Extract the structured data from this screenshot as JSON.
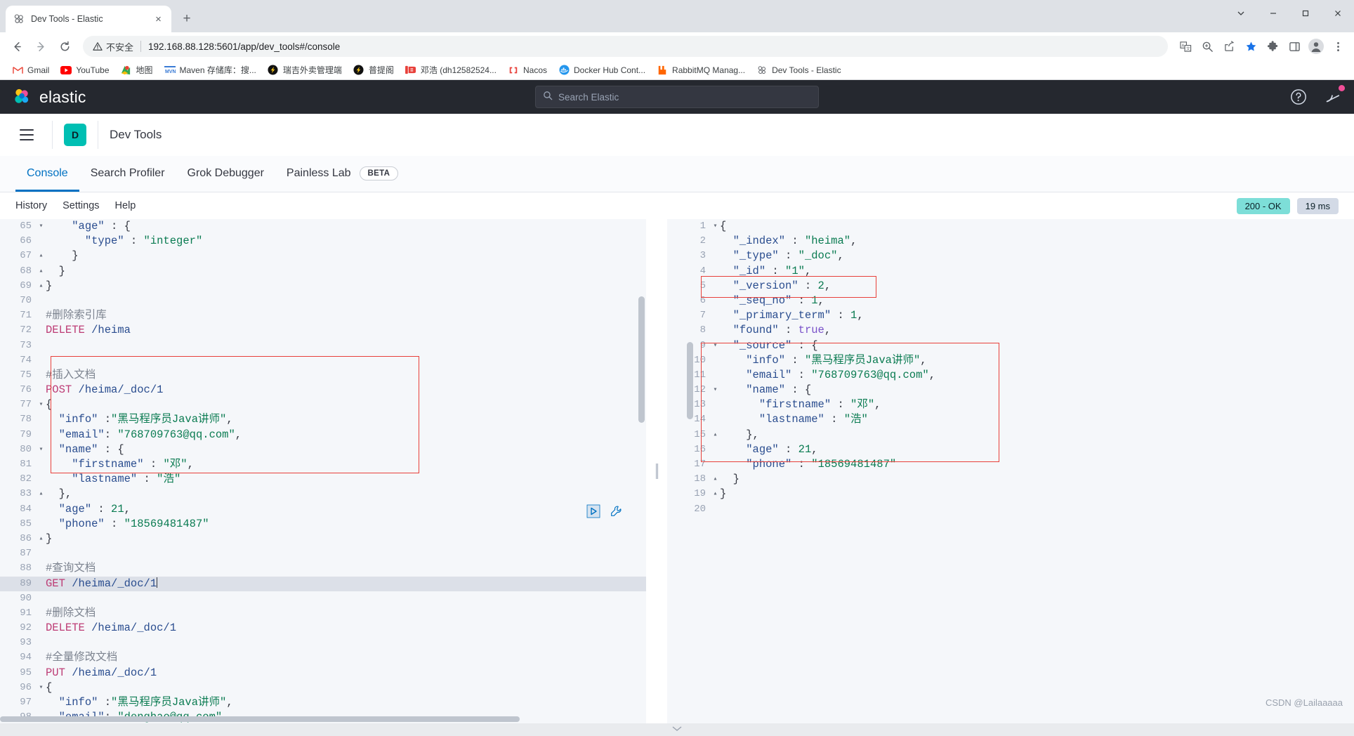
{
  "browser": {
    "tab": {
      "title": "Dev Tools - Elastic",
      "favicon": "elastic-favicon",
      "close_label": "×"
    },
    "new_tab_label": "+",
    "window_controls": {
      "chevron": "⌄",
      "minimize": "—",
      "maximize": "□",
      "close": "✕"
    },
    "nav": {
      "back": "←",
      "forward": "→",
      "reload": "⟳"
    },
    "omnibox": {
      "warning_text": "不安全",
      "url": "192.168.88.128:5601/app/dev_tools#/console",
      "url_host": "192.168.88.128:5601",
      "url_path": "/app/dev_tools#/console"
    },
    "toolbar_icons": [
      "translate-icon",
      "zoom-icon",
      "share-icon",
      "bookmark-star-icon",
      "extensions-puzzle-icon",
      "sidepanel-icon",
      "profile-avatar-icon",
      "chrome-menu-icon"
    ],
    "bookmarks": [
      {
        "label": "Gmail",
        "icon": "gmail-icon"
      },
      {
        "label": "YouTube",
        "icon": "youtube-icon"
      },
      {
        "label": "地图",
        "icon": "maps-icon"
      },
      {
        "label": "Maven 存储库：搜...",
        "icon": "maven-icon"
      },
      {
        "label": "瑞吉外卖管理端",
        "icon": "ruiji-icon"
      },
      {
        "label": "普提阁",
        "icon": "puti-icon"
      },
      {
        "label": "邓浩 (dh12582524...",
        "icon": "csdn-icon"
      },
      {
        "label": "Nacos",
        "icon": "nacos-icon"
      },
      {
        "label": "Docker Hub Cont...",
        "icon": "docker-icon"
      },
      {
        "label": "RabbitMQ Manag...",
        "icon": "rabbitmq-icon"
      },
      {
        "label": "Dev Tools - Elastic",
        "icon": "elastic-favicon"
      }
    ]
  },
  "elastic": {
    "brand": "elastic",
    "search_placeholder": "Search Elastic",
    "header_icons": [
      "help-icon",
      "notifications-icon"
    ],
    "breadcrumb": {
      "app_initial": "D",
      "title": "Dev Tools"
    },
    "tabs": [
      {
        "label": "Console",
        "active": true,
        "badge": ""
      },
      {
        "label": "Search Profiler",
        "active": false,
        "badge": ""
      },
      {
        "label": "Grok Debugger",
        "active": false,
        "badge": ""
      },
      {
        "label": "Painless Lab",
        "active": false,
        "badge": "BETA"
      }
    ],
    "toolbar": [
      "History",
      "Settings",
      "Help"
    ],
    "status": {
      "code": "200 - OK",
      "time": "19 ms"
    },
    "accent_colors": {
      "primary": "#0071c2",
      "app_icon_bg": "#00BFB3",
      "status_ok_bg": "#7dded8",
      "status_ms_bg": "#d3dae6",
      "annotation": "#e8403a",
      "header_bg": "#25282f"
    }
  },
  "request_editor": {
    "first_line": 64,
    "active_line": 89,
    "lines": [
      {
        "n": 65,
        "fold": "▾",
        "tokens": [
          {
            "t": "plain",
            "v": "    "
          },
          {
            "t": "key",
            "v": "\"age\""
          },
          {
            "t": "punc",
            "v": " : {"
          }
        ]
      },
      {
        "n": 66,
        "fold": "",
        "tokens": [
          {
            "t": "plain",
            "v": "      "
          },
          {
            "t": "key",
            "v": "\"type\""
          },
          {
            "t": "punc",
            "v": " : "
          },
          {
            "t": "str",
            "v": "\"integer\""
          }
        ]
      },
      {
        "n": 67,
        "fold": "▴",
        "tokens": [
          {
            "t": "punc",
            "v": "    }"
          }
        ]
      },
      {
        "n": 68,
        "fold": "▴",
        "tokens": [
          {
            "t": "punc",
            "v": "  }"
          }
        ]
      },
      {
        "n": 69,
        "fold": "▴",
        "tokens": [
          {
            "t": "punc",
            "v": "}"
          }
        ]
      },
      {
        "n": 70,
        "fold": "",
        "tokens": []
      },
      {
        "n": 71,
        "fold": "",
        "tokens": [
          {
            "t": "comment",
            "v": "#删除索引库"
          }
        ]
      },
      {
        "n": 72,
        "fold": "",
        "tokens": [
          {
            "t": "method",
            "v": "DELETE"
          },
          {
            "t": "url",
            "v": " /heima"
          }
        ]
      },
      {
        "n": 73,
        "fold": "",
        "tokens": []
      },
      {
        "n": 74,
        "fold": "",
        "tokens": []
      },
      {
        "n": 75,
        "fold": "",
        "tokens": [
          {
            "t": "comment",
            "v": "#插入文档"
          }
        ]
      },
      {
        "n": 76,
        "fold": "",
        "tokens": [
          {
            "t": "method",
            "v": "POST"
          },
          {
            "t": "url",
            "v": " /heima/_doc/1"
          }
        ]
      },
      {
        "n": 77,
        "fold": "▾",
        "tokens": [
          {
            "t": "punc",
            "v": "{"
          }
        ]
      },
      {
        "n": 78,
        "fold": "",
        "tokens": [
          {
            "t": "plain",
            "v": "  "
          },
          {
            "t": "key",
            "v": "\"info\""
          },
          {
            "t": "punc",
            "v": " :"
          },
          {
            "t": "str",
            "v": "\"黑马程序员Java讲师\""
          },
          {
            "t": "punc",
            "v": ","
          }
        ]
      },
      {
        "n": 79,
        "fold": "",
        "tokens": [
          {
            "t": "plain",
            "v": "  "
          },
          {
            "t": "key",
            "v": "\"email\""
          },
          {
            "t": "punc",
            "v": ": "
          },
          {
            "t": "str",
            "v": "\"768709763@qq.com\""
          },
          {
            "t": "punc",
            "v": ","
          }
        ]
      },
      {
        "n": 80,
        "fold": "▾",
        "tokens": [
          {
            "t": "plain",
            "v": "  "
          },
          {
            "t": "key",
            "v": "\"name\""
          },
          {
            "t": "punc",
            "v": " : {"
          }
        ]
      },
      {
        "n": 81,
        "fold": "",
        "tokens": [
          {
            "t": "plain",
            "v": "    "
          },
          {
            "t": "key",
            "v": "\"firstname\""
          },
          {
            "t": "punc",
            "v": " : "
          },
          {
            "t": "str",
            "v": "\"邓\""
          },
          {
            "t": "punc",
            "v": ","
          }
        ]
      },
      {
        "n": 82,
        "fold": "",
        "tokens": [
          {
            "t": "plain",
            "v": "    "
          },
          {
            "t": "key",
            "v": "\"lastname\""
          },
          {
            "t": "punc",
            "v": " : "
          },
          {
            "t": "str",
            "v": "\"浩\""
          }
        ]
      },
      {
        "n": 83,
        "fold": "▴",
        "tokens": [
          {
            "t": "punc",
            "v": "  },"
          }
        ]
      },
      {
        "n": 84,
        "fold": "",
        "tokens": [
          {
            "t": "plain",
            "v": "  "
          },
          {
            "t": "key",
            "v": "\"age\""
          },
          {
            "t": "punc",
            "v": " : "
          },
          {
            "t": "num",
            "v": "21"
          },
          {
            "t": "punc",
            "v": ","
          }
        ]
      },
      {
        "n": 85,
        "fold": "",
        "tokens": [
          {
            "t": "plain",
            "v": "  "
          },
          {
            "t": "key",
            "v": "\"phone\""
          },
          {
            "t": "punc",
            "v": " : "
          },
          {
            "t": "str",
            "v": "\"18569481487\""
          }
        ]
      },
      {
        "n": 86,
        "fold": "▴",
        "tokens": [
          {
            "t": "punc",
            "v": "}"
          }
        ]
      },
      {
        "n": 87,
        "fold": "",
        "tokens": []
      },
      {
        "n": 88,
        "fold": "",
        "tokens": [
          {
            "t": "comment",
            "v": "#查询文档"
          }
        ]
      },
      {
        "n": 89,
        "fold": "",
        "tokens": [
          {
            "t": "method",
            "v": "GET"
          },
          {
            "t": "url",
            "v": " /heima/_doc/1"
          },
          {
            "t": "caret",
            "v": ""
          }
        ]
      },
      {
        "n": 90,
        "fold": "",
        "tokens": []
      },
      {
        "n": 91,
        "fold": "",
        "tokens": [
          {
            "t": "comment",
            "v": "#删除文档"
          }
        ]
      },
      {
        "n": 92,
        "fold": "",
        "tokens": [
          {
            "t": "method",
            "v": "DELETE"
          },
          {
            "t": "url",
            "v": " /heima/_doc/1"
          }
        ]
      },
      {
        "n": 93,
        "fold": "",
        "tokens": []
      },
      {
        "n": 94,
        "fold": "",
        "tokens": [
          {
            "t": "comment",
            "v": "#全量修改文档"
          }
        ]
      },
      {
        "n": 95,
        "fold": "",
        "tokens": [
          {
            "t": "method",
            "v": "PUT"
          },
          {
            "t": "url",
            "v": " /heima/_doc/1"
          }
        ]
      },
      {
        "n": 96,
        "fold": "▾",
        "tokens": [
          {
            "t": "punc",
            "v": "{"
          }
        ]
      },
      {
        "n": 97,
        "fold": "",
        "tokens": [
          {
            "t": "plain",
            "v": "  "
          },
          {
            "t": "key",
            "v": "\"info\""
          },
          {
            "t": "punc",
            "v": " :"
          },
          {
            "t": "str",
            "v": "\"黑马程序员Java讲师\""
          },
          {
            "t": "punc",
            "v": ","
          }
        ]
      },
      {
        "n": 98,
        "fold": "",
        "tokens": [
          {
            "t": "plain",
            "v": "  "
          },
          {
            "t": "key",
            "v": "\"email\""
          },
          {
            "t": "punc",
            "v": ": "
          },
          {
            "t": "str",
            "v": "\"denghao@qq.com\""
          },
          {
            "t": "punc",
            "v": ","
          }
        ]
      }
    ],
    "actions": {
      "play": "play-icon",
      "wrench": "wrench-icon"
    }
  },
  "response_editor": {
    "lines": [
      {
        "n": 1,
        "fold": "▾",
        "tokens": [
          {
            "t": "punc",
            "v": "{"
          }
        ]
      },
      {
        "n": 2,
        "fold": "",
        "tokens": [
          {
            "t": "plain",
            "v": "  "
          },
          {
            "t": "key",
            "v": "\"_index\""
          },
          {
            "t": "punc",
            "v": " : "
          },
          {
            "t": "str",
            "v": "\"heima\""
          },
          {
            "t": "punc",
            "v": ","
          }
        ]
      },
      {
        "n": 3,
        "fold": "",
        "tokens": [
          {
            "t": "plain",
            "v": "  "
          },
          {
            "t": "key",
            "v": "\"_type\""
          },
          {
            "t": "punc",
            "v": " : "
          },
          {
            "t": "str",
            "v": "\"_doc\""
          },
          {
            "t": "punc",
            "v": ","
          }
        ]
      },
      {
        "n": 4,
        "fold": "",
        "tokens": [
          {
            "t": "plain",
            "v": "  "
          },
          {
            "t": "key",
            "v": "\"_id\""
          },
          {
            "t": "punc",
            "v": " : "
          },
          {
            "t": "str",
            "v": "\"1\""
          },
          {
            "t": "punc",
            "v": ","
          }
        ]
      },
      {
        "n": 5,
        "fold": "",
        "tokens": [
          {
            "t": "plain",
            "v": "  "
          },
          {
            "t": "key",
            "v": "\"_version\""
          },
          {
            "t": "punc",
            "v": " : "
          },
          {
            "t": "num",
            "v": "2"
          },
          {
            "t": "punc",
            "v": ","
          }
        ]
      },
      {
        "n": 6,
        "fold": "",
        "tokens": [
          {
            "t": "plain",
            "v": "  "
          },
          {
            "t": "key",
            "v": "\"_seq_no\""
          },
          {
            "t": "punc",
            "v": " : "
          },
          {
            "t": "num",
            "v": "1"
          },
          {
            "t": "punc",
            "v": ","
          }
        ]
      },
      {
        "n": 7,
        "fold": "",
        "tokens": [
          {
            "t": "plain",
            "v": "  "
          },
          {
            "t": "key",
            "v": "\"_primary_term\""
          },
          {
            "t": "punc",
            "v": " : "
          },
          {
            "t": "num",
            "v": "1"
          },
          {
            "t": "punc",
            "v": ","
          }
        ]
      },
      {
        "n": 8,
        "fold": "",
        "tokens": [
          {
            "t": "plain",
            "v": "  "
          },
          {
            "t": "key",
            "v": "\"found\""
          },
          {
            "t": "punc",
            "v": " : "
          },
          {
            "t": "bool",
            "v": "true"
          },
          {
            "t": "punc",
            "v": ","
          }
        ]
      },
      {
        "n": 9,
        "fold": "▾",
        "tokens": [
          {
            "t": "plain",
            "v": "  "
          },
          {
            "t": "key",
            "v": "\"_source\""
          },
          {
            "t": "punc",
            "v": " : {"
          }
        ]
      },
      {
        "n": 10,
        "fold": "",
        "tokens": [
          {
            "t": "plain",
            "v": "    "
          },
          {
            "t": "key",
            "v": "\"info\""
          },
          {
            "t": "punc",
            "v": " : "
          },
          {
            "t": "str",
            "v": "\"黑马程序员Java讲师\""
          },
          {
            "t": "punc",
            "v": ","
          }
        ]
      },
      {
        "n": 11,
        "fold": "",
        "tokens": [
          {
            "t": "plain",
            "v": "    "
          },
          {
            "t": "key",
            "v": "\"email\""
          },
          {
            "t": "punc",
            "v": " : "
          },
          {
            "t": "str",
            "v": "\"768709763@qq.com\""
          },
          {
            "t": "punc",
            "v": ","
          }
        ]
      },
      {
        "n": 12,
        "fold": "▾",
        "tokens": [
          {
            "t": "plain",
            "v": "    "
          },
          {
            "t": "key",
            "v": "\"name\""
          },
          {
            "t": "punc",
            "v": " : {"
          }
        ]
      },
      {
        "n": 13,
        "fold": "",
        "tokens": [
          {
            "t": "plain",
            "v": "      "
          },
          {
            "t": "key",
            "v": "\"firstname\""
          },
          {
            "t": "punc",
            "v": " : "
          },
          {
            "t": "str",
            "v": "\"邓\""
          },
          {
            "t": "punc",
            "v": ","
          }
        ]
      },
      {
        "n": 14,
        "fold": "",
        "tokens": [
          {
            "t": "plain",
            "v": "      "
          },
          {
            "t": "key",
            "v": "\"lastname\""
          },
          {
            "t": "punc",
            "v": " : "
          },
          {
            "t": "str",
            "v": "\"浩\""
          }
        ]
      },
      {
        "n": 15,
        "fold": "▴",
        "tokens": [
          {
            "t": "punc",
            "v": "    },"
          }
        ]
      },
      {
        "n": 16,
        "fold": "",
        "tokens": [
          {
            "t": "plain",
            "v": "    "
          },
          {
            "t": "key",
            "v": "\"age\""
          },
          {
            "t": "punc",
            "v": " : "
          },
          {
            "t": "num",
            "v": "21"
          },
          {
            "t": "punc",
            "v": ","
          }
        ]
      },
      {
        "n": 17,
        "fold": "",
        "tokens": [
          {
            "t": "plain",
            "v": "    "
          },
          {
            "t": "key",
            "v": "\"phone\""
          },
          {
            "t": "punc",
            "v": " : "
          },
          {
            "t": "str",
            "v": "\"18569481487\""
          }
        ]
      },
      {
        "n": 18,
        "fold": "▴",
        "tokens": [
          {
            "t": "punc",
            "v": "  }"
          }
        ]
      },
      {
        "n": 19,
        "fold": "▴",
        "tokens": [
          {
            "t": "punc",
            "v": "}"
          }
        ]
      },
      {
        "n": 20,
        "fold": "",
        "tokens": []
      }
    ]
  },
  "watermark": "CSDN @Lailaaaaa"
}
